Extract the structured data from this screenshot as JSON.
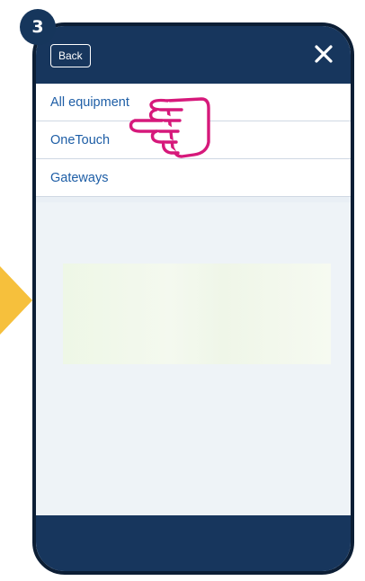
{
  "step": {
    "number": "3"
  },
  "header": {
    "back_label": "Back"
  },
  "menu": {
    "items": [
      {
        "label": "All equipment"
      },
      {
        "label": "OneTouch"
      },
      {
        "label": "Gateways"
      }
    ]
  },
  "icons": {
    "close": "close-icon",
    "pointer": "hand-pointer-icon",
    "arrow": "arrow-right-icon"
  },
  "colors": {
    "header": "#17365d",
    "link": "#1e5ea6",
    "pointer": "#d6197b",
    "arrow": "#f6c03c"
  }
}
